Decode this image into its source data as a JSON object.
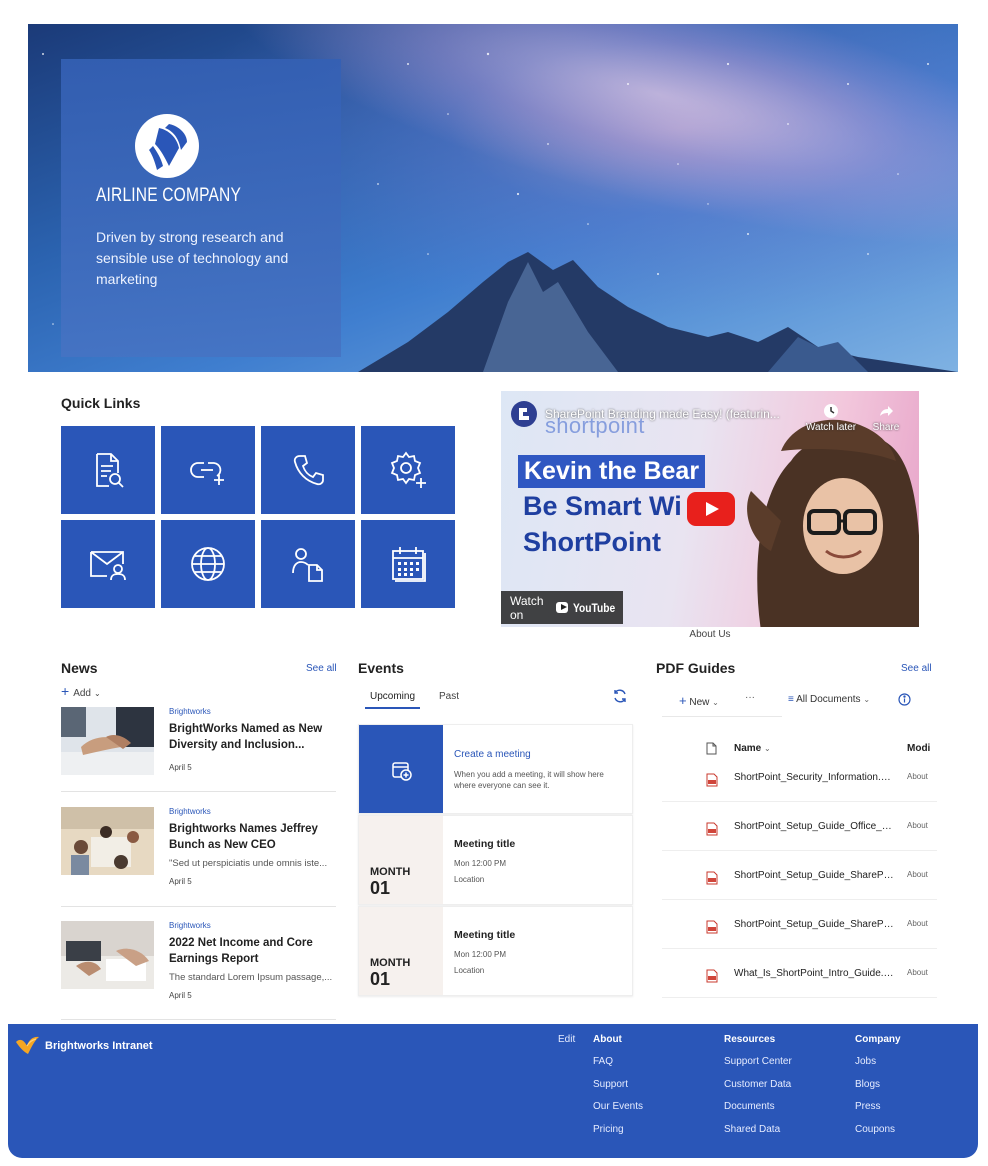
{
  "hero": {
    "brand": "AIRLINE COMPANY",
    "tagline": "Driven by strong research and sensible use of technology and marketing"
  },
  "quick_links": {
    "title": "Quick Links",
    "tiles": [
      {
        "icon": "document-search-icon"
      },
      {
        "icon": "link-add-icon"
      },
      {
        "icon": "phone-icon"
      },
      {
        "icon": "settings-add-icon"
      },
      {
        "icon": "mail-person-icon"
      },
      {
        "icon": "globe-icon"
      },
      {
        "icon": "person-document-icon"
      },
      {
        "icon": "calendar-icon"
      }
    ]
  },
  "video": {
    "title": "SharePoint Branding made Easy! (featurin...",
    "channel_word": "shortpoint",
    "watch_later": "Watch later",
    "share": "Share",
    "line1": "Kevin the Bear",
    "line2": "Be Smart Wi",
    "line3": "ShortPoint",
    "watch_on": "Watch on",
    "youtube": "YouTube",
    "caption": "About Us"
  },
  "news": {
    "title": "News",
    "see_all": "See all",
    "add": "Add",
    "items": [
      {
        "category": "Brightworks",
        "title": "BrightWorks Named as New Diversity and Inclusion...",
        "desc": "",
        "date": "April 5"
      },
      {
        "category": "Brightworks",
        "title": "Brightworks Names Jeffrey Bunch as New CEO",
        "desc": "\"Sed ut perspiciatis unde omnis iste...",
        "date": "April 5"
      },
      {
        "category": "Brightworks",
        "title": "2022 Net Income and Core Earnings Report",
        "desc": "The standard Lorem Ipsum passage,...",
        "date": "April 5"
      }
    ]
  },
  "events": {
    "title": "Events",
    "tabs": [
      "Upcoming",
      "Past"
    ],
    "create_title": "Create a meeting",
    "create_desc": "When you add a meeting, it will show here where everyone can see it.",
    "items": [
      {
        "month": "MONTH",
        "day": "01",
        "title": "Meeting title",
        "time": "Mon 12:00 PM",
        "location": "Location"
      },
      {
        "month": "MONTH",
        "day": "01",
        "title": "Meeting title",
        "time": "Mon 12:00 PM",
        "location": "Location"
      }
    ]
  },
  "pdf": {
    "title": "PDF Guides",
    "see_all": "See all",
    "new": "New",
    "more": "···",
    "view": "All Documents",
    "col_name": "Name",
    "col_mod": "Modi",
    "files": [
      {
        "name": "ShortPoint_Security_Information.p...",
        "mod": "About"
      },
      {
        "name": "ShortPoint_Setup_Guide_Office_3...",
        "mod": "About"
      },
      {
        "name": "ShortPoint_Setup_Guide_SharePoi...",
        "mod": "About"
      },
      {
        "name": "ShortPoint_Setup_Guide_SharePoi...",
        "mod": "About"
      },
      {
        "name": "What_Is_ShortPoint_Intro_Guide.p...",
        "mod": "About"
      }
    ]
  },
  "footer": {
    "brand": "Brightworks Intranet",
    "edit": "Edit",
    "columns": [
      {
        "head": "About",
        "links": [
          "FAQ",
          "Support",
          "Our Events",
          "Pricing"
        ]
      },
      {
        "head": "Resources",
        "links": [
          "Support Center",
          "Customer Data",
          "Documents",
          "Shared Data"
        ]
      },
      {
        "head": "Company",
        "links": [
          "Jobs",
          "Blogs",
          "Press",
          "Coupons"
        ]
      }
    ]
  },
  "colors": {
    "accent": "#2a56b8",
    "hero_card": "#3460b4",
    "youtube_red": "#e8201c"
  }
}
